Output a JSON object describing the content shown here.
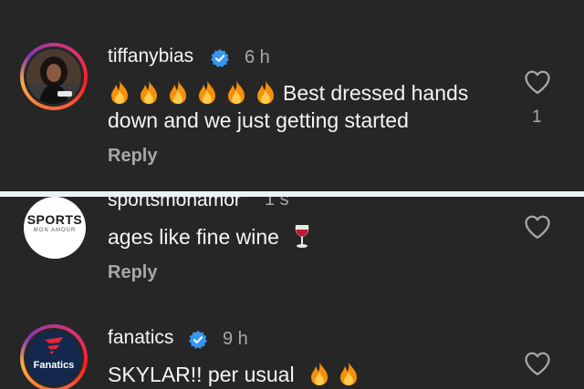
{
  "comments": [
    {
      "username": "tiffanybias",
      "verified": true,
      "time": "6 h",
      "text_line1": "Best dressed hands",
      "text_line2": "down and we just getting started",
      "reply_label": "Reply",
      "like_count": "1",
      "emoji": [
        "fire",
        "fire",
        "fire",
        "fire",
        "fire",
        "fire"
      ]
    },
    {
      "username": "sportsmonamor",
      "time": "1 s",
      "text": "ages like fine wine",
      "reply_label": "Reply",
      "avatar_line1": "SPORTS",
      "avatar_line2": "MON AMOUR",
      "emoji": [
        "wine-glass"
      ]
    },
    {
      "username": "fanatics",
      "verified": true,
      "time": "9 h",
      "text": "SKYLAR!! per usual",
      "avatar_label": "Fanatics",
      "emoji": [
        "fire",
        "fire"
      ]
    }
  ],
  "colors": {
    "background": "#262626",
    "secondary_text": "#a8a8a8",
    "verified_blue": "#3797f0",
    "divider": "#eaf2f5",
    "fanatics_navy": "#13284c",
    "fanatics_red": "#e32636"
  }
}
